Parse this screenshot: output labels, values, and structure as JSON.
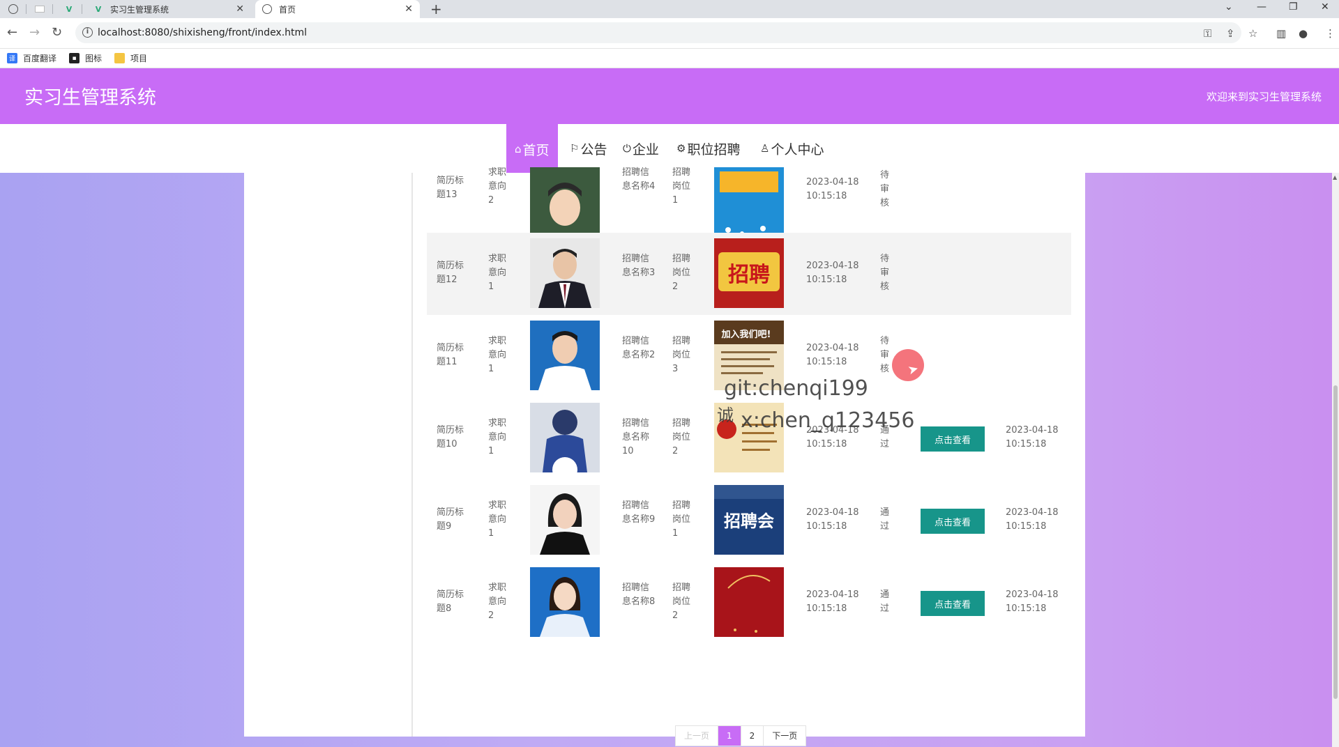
{
  "browser": {
    "tabs": [
      {
        "title": "实习生管理系统"
      },
      {
        "title": "首页"
      }
    ],
    "url": "localhost:8080/shixisheng/front/index.html",
    "bookmarks": [
      "百度翻译",
      "图标",
      "项目"
    ]
  },
  "header": {
    "title": "实习生管理系统",
    "welcome": "欢迎来到实习生管理系统"
  },
  "menu": [
    {
      "label": "首页",
      "icon": "home-icon"
    },
    {
      "label": "公告",
      "icon": "flag-icon"
    },
    {
      "label": "企业",
      "icon": "power-icon"
    },
    {
      "label": "职位招聘",
      "icon": "gear-icon"
    },
    {
      "label": "个人中心",
      "icon": "user-icon"
    }
  ],
  "rows": [
    {
      "title": "简历标题13",
      "intent": "求职意向2",
      "info": "招聘信息名称4",
      "position": "招聘岗位1",
      "time": "2023-04-18 10:15:18",
      "status": "待审核",
      "action": "",
      "time2": ""
    },
    {
      "title": "简历标题12",
      "intent": "求职意向1",
      "info": "招聘信息名称3",
      "position": "招聘岗位2",
      "time": "2023-04-18 10:15:18",
      "status": "待审核",
      "action": "",
      "time2": ""
    },
    {
      "title": "简历标题11",
      "intent": "求职意向1",
      "info": "招聘信息名称2",
      "position": "招聘岗位3",
      "time": "2023-04-18 10:15:18",
      "status": "待审核",
      "action": "",
      "time2": ""
    },
    {
      "title": "简历标题10",
      "intent": "求职意向1",
      "info": "招聘信息名称10",
      "position": "招聘岗位2",
      "time": "2023-04-18 10:15:18",
      "status": "通过",
      "action": "点击查看",
      "time2": "2023-04-18 10:15:18"
    },
    {
      "title": "简历标题9",
      "intent": "求职意向1",
      "info": "招聘信息名称9",
      "position": "招聘岗位1",
      "time": "2023-04-18 10:15:18",
      "status": "通过",
      "action": "点击查看",
      "time2": "2023-04-18 10:15:18"
    },
    {
      "title": "简历标题8",
      "intent": "求职意向2",
      "info": "招聘信息名称8",
      "position": "招聘岗位2",
      "time": "2023-04-18 10:15:18",
      "status": "通过",
      "action": "点击查看",
      "time2": "2023-04-18 10:15:18"
    }
  ],
  "posters": {
    "row1": "招聘",
    "row2": "加入我们吧!",
    "row4": "招聘会"
  },
  "pager": {
    "prev": "上一页",
    "pages": [
      "1",
      "2"
    ],
    "next": "下一页"
  },
  "watermark": {
    "line1": "git:chenqi199",
    "line2": "x:chen_q123456",
    "char": "诚"
  },
  "colors": {
    "header": "#c86cf6",
    "button": "#17958a"
  }
}
